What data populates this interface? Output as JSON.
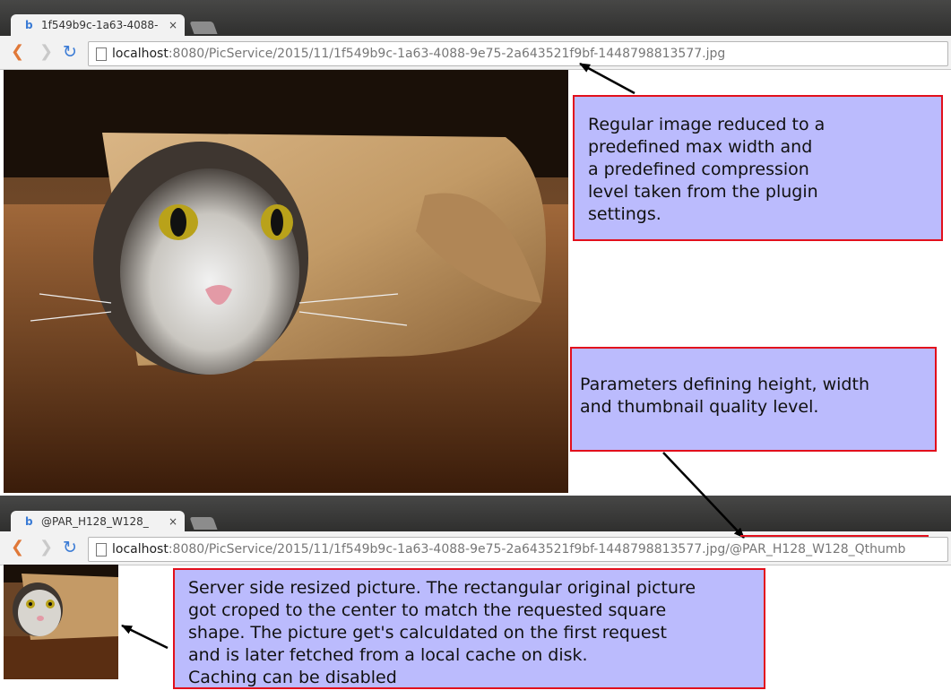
{
  "window1": {
    "tab_title": "1f549b9c-1a63-4088-",
    "tab_close": "×",
    "url_host": "localhost",
    "url_rest": ":8080/PicService/2015/11/1f549b9c-1a63-4088-9e75-2a643521f9bf-1448798813577.jpg"
  },
  "window2": {
    "tab_title": "@PAR_H128_W128_",
    "tab_close": "×",
    "url_host": "localhost",
    "url_rest": ":8080/PicService/2015/11/1f549b9c-1a63-4088-9e75-2a643521f9bf-1448798813577.jpg/@PAR_H128_W128_Qthumb"
  },
  "nav": {
    "back": "❮",
    "forward": "❯",
    "reload": "↻"
  },
  "annotations": {
    "regular_image": "Regular image reduced to a\npredefined max width and\na predefined compression\nlevel taken from the plugin\nsettings.",
    "parameters": "Parameters defining height, width\nand thumbnail quality level.",
    "server_side": "Server side resized picture. The rectangular original picture\ngot croped to the center to match the requested square\nshape. The picture get's calculdated on the first request\nand is later fetched from a local cache on disk.\nCaching can be disabled"
  },
  "colors": {
    "annotation_fill": "#bbbbfd",
    "annotation_border": "#e20f1c",
    "arrow": "#000000"
  },
  "icons": [
    "favicon-icon",
    "close-icon",
    "new-tab-icon",
    "back-icon",
    "forward-icon",
    "reload-icon",
    "page-icon",
    "arrow-icon"
  ]
}
